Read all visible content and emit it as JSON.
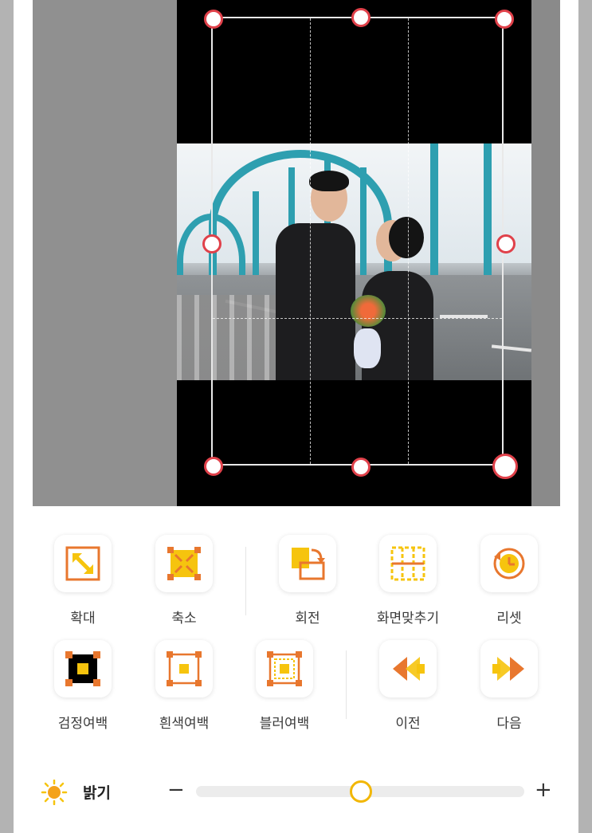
{
  "editor": {
    "crop_handles": [
      "top-left",
      "top-center",
      "top-right",
      "middle-left",
      "middle-right",
      "bottom-left",
      "bottom-center",
      "bottom-right"
    ]
  },
  "tools": {
    "row1": [
      {
        "id": "zoom-in",
        "label": "확대",
        "icon": "expand-arrow-icon"
      },
      {
        "id": "zoom-out",
        "label": "축소",
        "icon": "shrink-arrows-icon"
      },
      {
        "id": "rotate",
        "label": "회전",
        "icon": "rotate-icon"
      },
      {
        "id": "fit-screen",
        "label": "화면맞추기",
        "icon": "fit-grid-icon"
      },
      {
        "id": "reset",
        "label": "리셋",
        "icon": "clock-reset-icon"
      }
    ],
    "row2": [
      {
        "id": "black-margin",
        "label": "검정여백",
        "icon": "black-frame-icon"
      },
      {
        "id": "white-margin",
        "label": "흰색여백",
        "icon": "white-frame-icon"
      },
      {
        "id": "blur-margin",
        "label": "블러여백",
        "icon": "blur-frame-icon"
      },
      {
        "id": "previous",
        "label": "이전",
        "icon": "double-arrow-left-icon"
      },
      {
        "id": "next",
        "label": "다음",
        "icon": "double-arrow-right-icon"
      }
    ]
  },
  "brightness": {
    "label": "밝기",
    "minus": "−",
    "plus": "+",
    "value_fraction": 0.5
  },
  "colors": {
    "accent_orange": "#e8772e",
    "accent_yellow": "#f6c40e",
    "handle_red": "#e0414a"
  }
}
